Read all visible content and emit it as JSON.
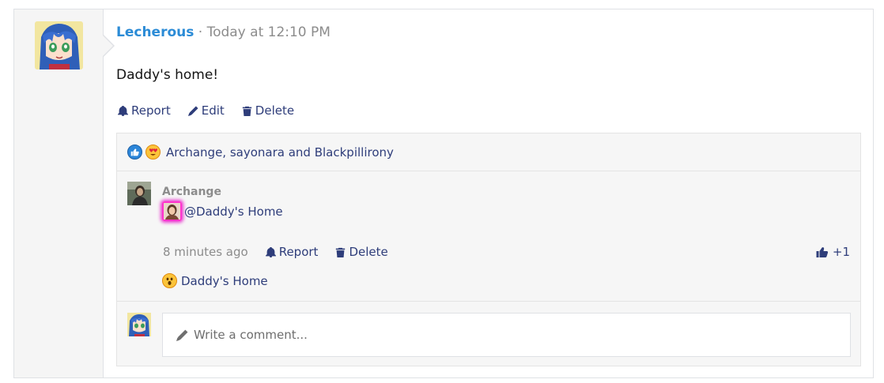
{
  "post": {
    "username": "Lecherous",
    "separator": "·",
    "time": "Today at 12:10 PM",
    "body": "Daddy's home!",
    "actions": {
      "report": "Report",
      "edit": "Edit",
      "delete": "Delete"
    }
  },
  "reactions": {
    "icons": [
      "like-reaction-icon",
      "love-reaction-icon"
    ],
    "summary": "Archange, sayonara and Blackpillirony"
  },
  "comment": {
    "author": "Archange",
    "mention_text": "@Daddy's Home",
    "time": "8 minutes ago",
    "report": "Report",
    "delete": "Delete",
    "like_count": "+1",
    "reaction_user": "Daddy's Home",
    "reaction_icon": "wow-reaction-icon"
  },
  "reply": {
    "placeholder": "Write a comment..."
  },
  "colors": {
    "username": "#2b8bd6",
    "link": "#2e3d7a",
    "muted": "#8c8c8c",
    "mention_glow": "#ff33cc"
  }
}
